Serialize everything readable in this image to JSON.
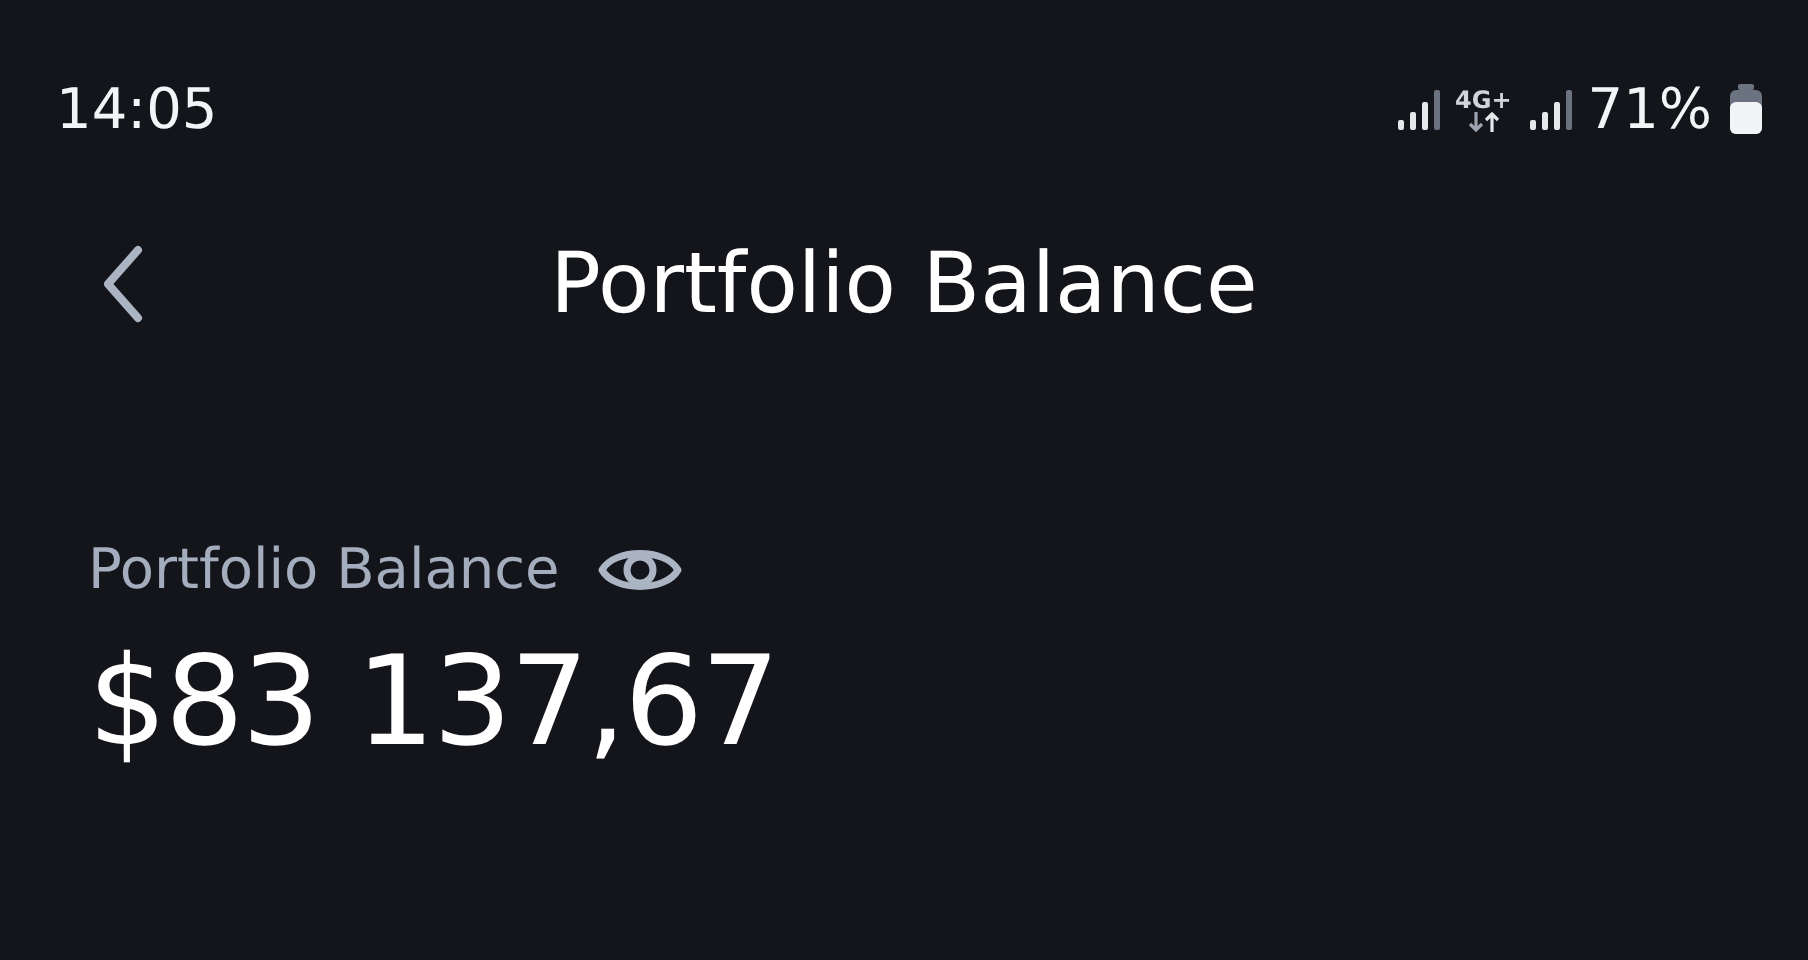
{
  "status_bar": {
    "time": "14:05",
    "network": "4G+",
    "battery": "71%"
  },
  "header": {
    "title": "Portfolio Balance"
  },
  "balance": {
    "label": "Portfolio Balance",
    "amount": "$83 137,67"
  }
}
